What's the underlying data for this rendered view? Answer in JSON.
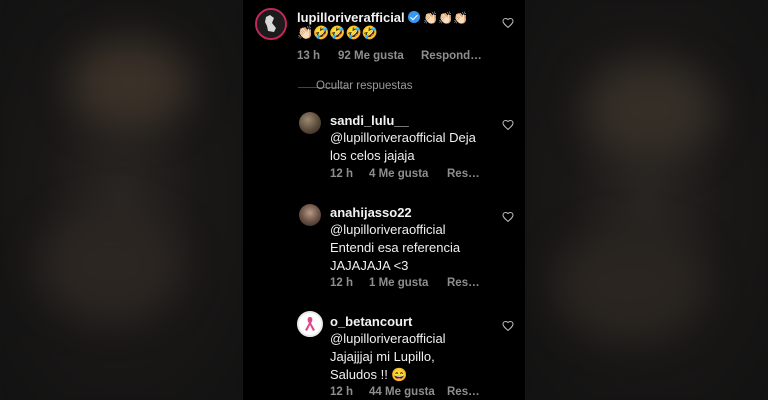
{
  "comments": [
    {
      "username": "lupilloriverafficial",
      "verified": true,
      "lines": [
        "👏🏻👏🏻👏🏻",
        "👏🏻🤣🤣🤣🤣"
      ],
      "time": "13 h",
      "likes": "92 Me gusta",
      "reply": "Respond…"
    },
    {
      "username": "sandi_lulu__",
      "lines": [
        "@lupilloriveraofficial Deja",
        "los celos jajaja"
      ],
      "time": "12 h",
      "likes": "4 Me gusta",
      "reply": "Res…"
    },
    {
      "username": "anahijasso22",
      "lines": [
        "@lupilloriveraofficial",
        "Entendi esa referencia",
        "JAJAJAJA <3"
      ],
      "time": "12 h",
      "likes": "1 Me gusta",
      "reply": "Res…"
    },
    {
      "username": "o_betancourt",
      "lines": [
        "@lupilloriveraofficial",
        "Jajajjjaj mi Lupillo,",
        "Saludos !! 😄"
      ],
      "time": "12 h",
      "likes": "44 Me gusta",
      "reply": "Res…"
    }
  ],
  "hide_replies": "Ocultar respuestas",
  "icons": {
    "like": "heart-icon",
    "verified": "verified-badge-icon"
  }
}
